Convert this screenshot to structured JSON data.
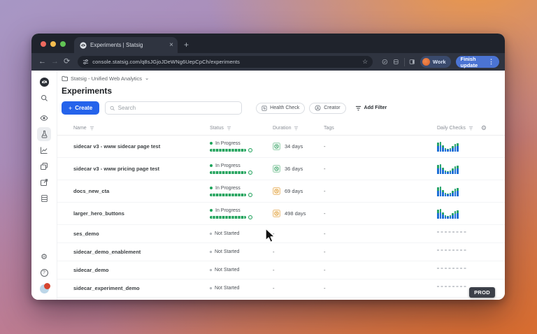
{
  "browser": {
    "tab": {
      "title": "Experiments | Statsig",
      "close_glyph": "×",
      "new_tab_glyph": "+"
    },
    "nav": {
      "back_glyph": "←",
      "forward_glyph": "→",
      "refresh_glyph": "⟳",
      "star_glyph": "☆"
    },
    "address": {
      "url": "console.statsig.com/q8sJGjoJDeWNg6UepCpCh/experiments"
    },
    "profile": {
      "label": "Work"
    },
    "update_button": {
      "label": "Finish update",
      "menu_glyph": "⋮"
    }
  },
  "sidebar": {
    "icons": [
      "statsig-logo",
      "search",
      "eye",
      "flask",
      "metrics",
      "layers",
      "export",
      "storage",
      "settings",
      "help",
      "avatar"
    ],
    "help_glyph": "?",
    "settings_glyph": "⚙"
  },
  "page": {
    "breadcrumb": {
      "workspace": "Statsig - Unified Web Analytics",
      "chevron_glyph": "⌄"
    },
    "title": "Experiments",
    "toolbar": {
      "create_label": "Create",
      "create_plus_glyph": "+",
      "search_placeholder": "Search",
      "filters": [
        {
          "label": "Health Check"
        },
        {
          "label": "Creator"
        },
        {
          "label": "Add Filter"
        }
      ]
    },
    "env_badge": "PROD",
    "header_gear_glyph": "⚙"
  },
  "table": {
    "headers": {
      "name": "Name",
      "status": "Status",
      "duration": "Duration",
      "tags": "Tags",
      "daily_checks": "Daily Checks"
    },
    "rows": [
      {
        "name": "sidecar v3 - www sidecar page test",
        "state": "in_progress",
        "status": "In Progress",
        "duration": "34 days",
        "duration_health": "ok",
        "tags": "-"
      },
      {
        "name": "sidecar v3 - www pricing page test",
        "state": "in_progress",
        "status": "In Progress",
        "duration": "36 days",
        "duration_health": "ok",
        "tags": "-"
      },
      {
        "name": "docs_new_cta",
        "state": "in_progress",
        "status": "In Progress",
        "duration": "69 days",
        "duration_health": "warn",
        "tags": "-"
      },
      {
        "name": "larger_hero_buttons",
        "state": "in_progress",
        "status": "In Progress",
        "duration": "498 days",
        "duration_health": "warn",
        "tags": "-"
      },
      {
        "name": "ses_demo",
        "state": "not_started",
        "status": "Not Started",
        "duration": "-",
        "tags": "-"
      },
      {
        "name": "sidecar_demo_enablement",
        "state": "not_started",
        "status": "Not Started",
        "duration": "-",
        "tags": "-"
      },
      {
        "name": "sidecar_demo",
        "state": "not_started",
        "status": "Not Started",
        "duration": "-",
        "tags": "-"
      },
      {
        "name": "sidecar_experiment_demo",
        "state": "not_started",
        "status": "Not Started",
        "duration": "-",
        "tags": "-"
      }
    ]
  },
  "chart_data": {
    "type": "bar",
    "note": "daily-checks sparkline shown for each in-progress row",
    "bars": [
      {
        "total": 13,
        "green": 5
      },
      {
        "total": 14,
        "green": 5
      },
      {
        "total": 9,
        "green": 3
      },
      {
        "total": 5,
        "green": 2
      },
      {
        "total": 4,
        "green": 1
      },
      {
        "total": 5,
        "green": 2
      },
      {
        "total": 8,
        "green": 3
      },
      {
        "total": 11,
        "green": 4
      },
      {
        "total": 12,
        "green": 4
      }
    ]
  },
  "colors": {
    "accent_blue": "#2563eb",
    "status_green": "#1ea55b",
    "warn_orange": "#dd9a33",
    "spark_blue": "#1d6fd6",
    "spark_green": "#27a567",
    "chrome_frame": "#1f232c",
    "chrome_toolbar": "#2f3440",
    "env_badge_bg": "#3c4049"
  }
}
